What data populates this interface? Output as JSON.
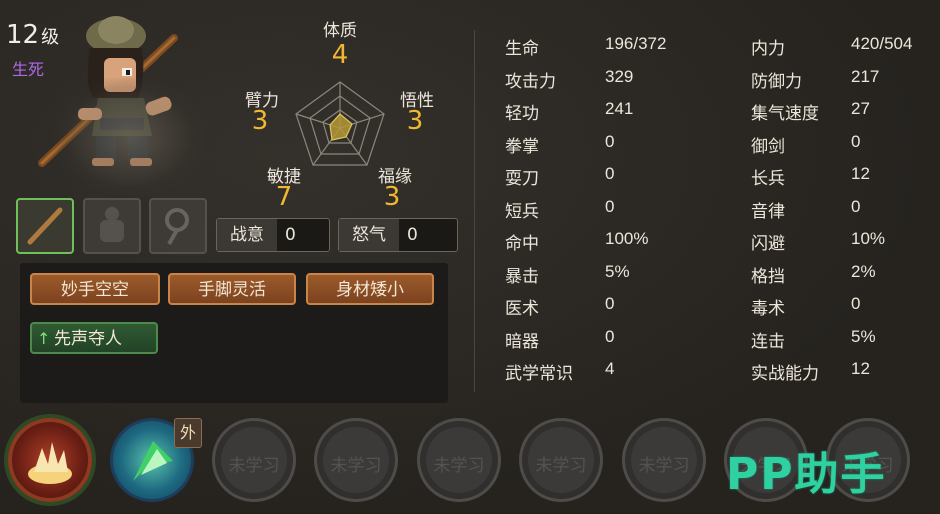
{
  "character": {
    "level_number": "12",
    "level_unit": "级",
    "realm": "生死"
  },
  "attributes": [
    {
      "label": "体质",
      "value": "4"
    },
    {
      "label": "悟性",
      "value": "3"
    },
    {
      "label": "福缘",
      "value": "3"
    },
    {
      "label": "敏捷",
      "value": "7"
    },
    {
      "label": "臂力",
      "value": "3"
    }
  ],
  "combat": {
    "fighting_spirit_label": "战意",
    "fighting_spirit_value": "0",
    "rage_label": "怒气",
    "rage_value": "0"
  },
  "traits": [
    "妙手空空",
    "手脚灵活",
    "身材矮小",
    "先声夺人"
  ],
  "stats_left": [
    {
      "name": "生命",
      "value": "196/372"
    },
    {
      "name": "攻击力",
      "value": "329"
    },
    {
      "name": "轻功",
      "value": "241"
    },
    {
      "name": "拳掌",
      "value": "0"
    },
    {
      "name": "耍刀",
      "value": "0"
    },
    {
      "name": "短兵",
      "value": "0"
    },
    {
      "name": "命中",
      "value": "100%"
    },
    {
      "name": "暴击",
      "value": "5%"
    },
    {
      "name": "医术",
      "value": "0"
    },
    {
      "name": "暗器",
      "value": "0"
    },
    {
      "name": "武学常识",
      "value": "4"
    }
  ],
  "stats_right": [
    {
      "name": "内力",
      "value": "420/504"
    },
    {
      "name": "防御力",
      "value": "217"
    },
    {
      "name": "集气速度",
      "value": "27"
    },
    {
      "name": "御剑",
      "value": "0"
    },
    {
      "name": "长兵",
      "value": "12"
    },
    {
      "name": "音律",
      "value": "0"
    },
    {
      "name": "闪避",
      "value": "10%"
    },
    {
      "name": "格挡",
      "value": "2%"
    },
    {
      "name": "毒术",
      "value": "0"
    },
    {
      "name": "连击",
      "value": "5%"
    },
    {
      "name": "实战能力",
      "value": "12"
    }
  ],
  "skills": {
    "badge": "外",
    "locked_label": "未学习"
  },
  "watermark": "PP助手",
  "colors": {
    "accent_gold": "#f0b731",
    "realm_purple": "#b069e8",
    "trait_orange": "#9b5a2a",
    "trait_green": "#2f5a33",
    "watermark_green": "#2fd1a0"
  }
}
